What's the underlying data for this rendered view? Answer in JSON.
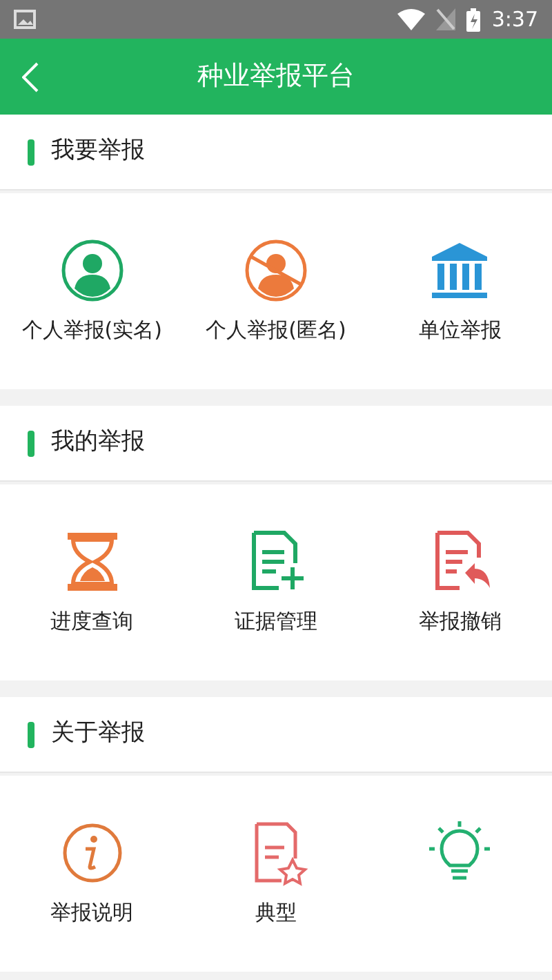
{
  "status_bar": {
    "time": "3:37"
  },
  "header": {
    "title": "种业举报平台"
  },
  "sections": [
    {
      "title": "我要举报",
      "items": [
        {
          "kind": "person",
          "label": "个人举报(实名)"
        },
        {
          "kind": "anonymous",
          "label": "个人举报(匿名)"
        },
        {
          "kind": "building",
          "label": "单位举报"
        }
      ]
    },
    {
      "title": "我的举报",
      "items": [
        {
          "kind": "hourglass",
          "label": "进度查询"
        },
        {
          "kind": "doc-add",
          "label": "证据管理"
        },
        {
          "kind": "doc-undo",
          "label": "举报撤销"
        }
      ]
    },
    {
      "title": "关于举报",
      "items": [
        {
          "kind": "info",
          "label": "举报说明"
        },
        {
          "kind": "doc-star",
          "label": "典型"
        },
        {
          "kind": "bulb"
        }
      ]
    }
  ]
}
